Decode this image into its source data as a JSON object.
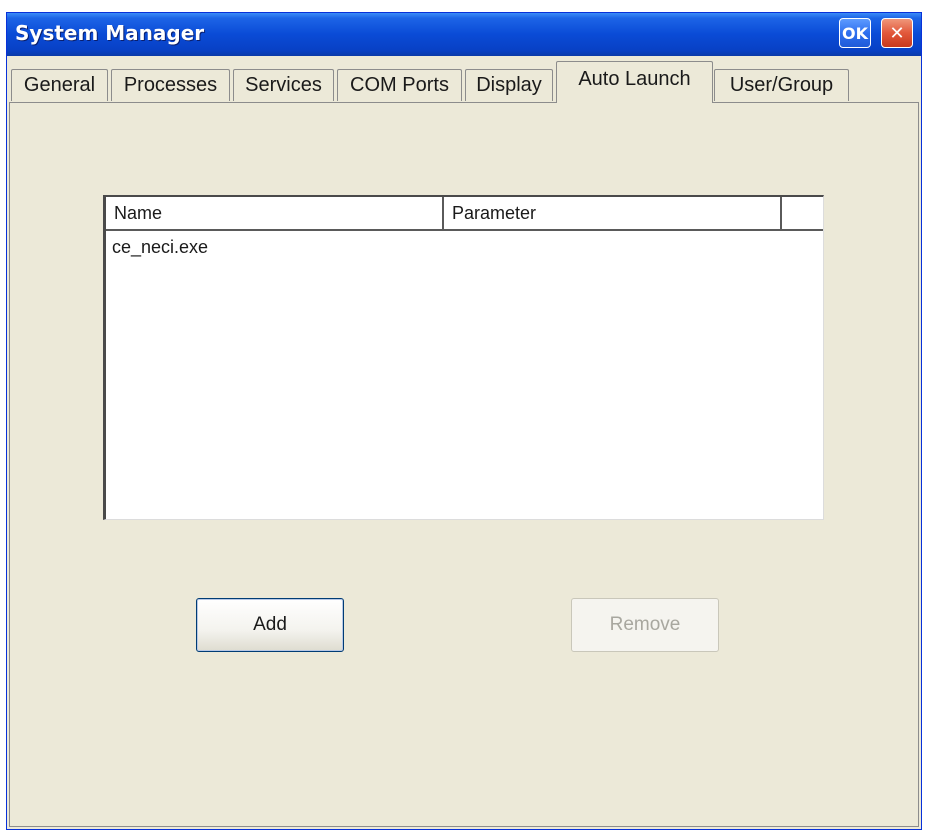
{
  "window": {
    "title": "System Manager",
    "ok_label": "OK",
    "close_label": "✕"
  },
  "tabs": [
    {
      "label": "General",
      "active": false
    },
    {
      "label": "Processes",
      "active": false
    },
    {
      "label": "Services",
      "active": false
    },
    {
      "label": "COM Ports",
      "active": false
    },
    {
      "label": "Display",
      "active": false
    },
    {
      "label": "Auto Launch",
      "active": true
    },
    {
      "label": "User/Group",
      "active": false
    }
  ],
  "listview": {
    "columns": [
      "Name",
      "Parameter"
    ],
    "rows": [
      {
        "name": "ce_neci.exe",
        "parameter": ""
      }
    ]
  },
  "buttons": {
    "add_label": "Add",
    "remove_label": "Remove",
    "remove_enabled": false
  },
  "colors": {
    "titlebar": "#0a4bd6",
    "face": "#ece9d8",
    "close": "#e2583b"
  }
}
